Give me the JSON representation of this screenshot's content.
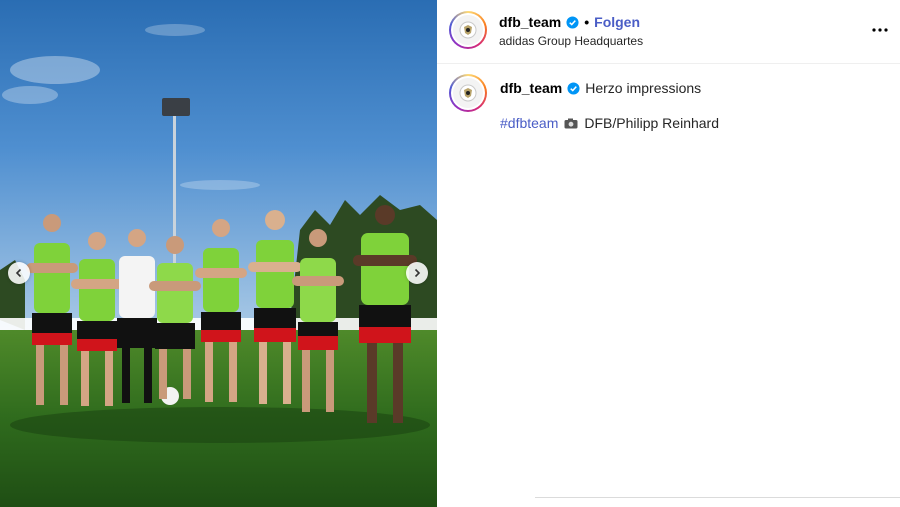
{
  "post": {
    "username": "dfb_team",
    "follow_label": "Folgen",
    "separator": "•",
    "location": "adidas Group Headquartes"
  },
  "caption": {
    "username": "dfb_team",
    "text": "Herzo impressions",
    "hashtag": "#dfbteam",
    "credit": "DFB/Philipp Reinhard"
  },
  "media": {
    "photo_description_icon": "team-photo",
    "shirt_colors": [
      "#7fd23a",
      "#b8e04a",
      "#ffffff"
    ],
    "shorts_colors": [
      "#111111",
      "#d0141b"
    ]
  },
  "colors": {
    "accent": "#4a5dc6",
    "verified": "#0095f6"
  }
}
